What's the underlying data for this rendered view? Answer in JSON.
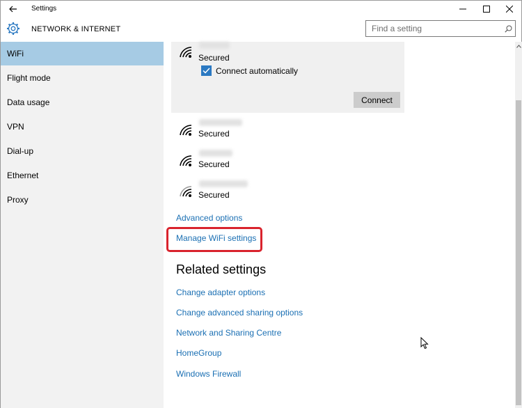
{
  "window": {
    "title": "Settings",
    "controls": [
      "minimize-icon",
      "maximize-icon",
      "close-icon"
    ]
  },
  "header": {
    "title": "NETWORK & INTERNET",
    "icon": "gear-icon",
    "search_placeholder": "Find a setting"
  },
  "sidebar": {
    "items": [
      {
        "label": "WiFi",
        "active": true
      },
      {
        "label": "Flight mode"
      },
      {
        "label": "Data usage"
      },
      {
        "label": "VPN"
      },
      {
        "label": "Dial-up"
      },
      {
        "label": "Ethernet"
      },
      {
        "label": "Proxy"
      }
    ]
  },
  "networks": {
    "selected": {
      "status": "Secured",
      "auto_connect_label": "Connect automatically",
      "auto_connect_checked": true,
      "connect_label": "Connect"
    },
    "list": [
      {
        "status": "Secured"
      },
      {
        "status": "Secured"
      },
      {
        "status": "Secured"
      }
    ]
  },
  "links": {
    "advanced_options": "Advanced options",
    "manage_wifi": "Manage WiFi settings"
  },
  "related": {
    "heading": "Related settings",
    "items": [
      "Change adapter options",
      "Change advanced sharing options",
      "Network and Sharing Centre",
      "HomeGroup",
      "Windows Firewall"
    ]
  },
  "colors": {
    "accent": "#2b79c2",
    "link": "#1a6fb3",
    "nav_active": "#a6cbe4",
    "highlight": "#d9232d"
  }
}
